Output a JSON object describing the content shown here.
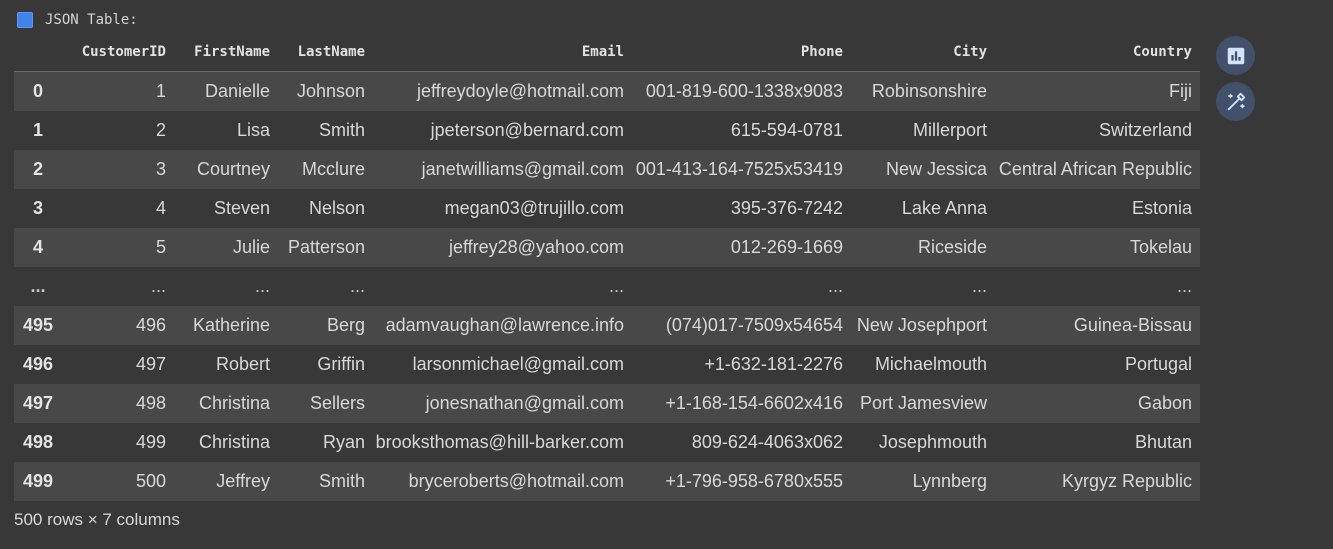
{
  "output_label": "JSON Table:",
  "table": {
    "index_header": "",
    "columns": [
      "CustomerID",
      "FirstName",
      "LastName",
      "Email",
      "Phone",
      "City",
      "Country"
    ],
    "rows": [
      {
        "index": "0",
        "cells": [
          "1",
          "Danielle",
          "Johnson",
          "jeffreydoyle@hotmail.com",
          "001-819-600-1338x9083",
          "Robinsonshire",
          "Fiji"
        ]
      },
      {
        "index": "1",
        "cells": [
          "2",
          "Lisa",
          "Smith",
          "jpeterson@bernard.com",
          "615-594-0781",
          "Millerport",
          "Switzerland"
        ]
      },
      {
        "index": "2",
        "cells": [
          "3",
          "Courtney",
          "Mcclure",
          "janetwilliams@gmail.com",
          "001-413-164-7525x53419",
          "New Jessica",
          "Central African Republic"
        ]
      },
      {
        "index": "3",
        "cells": [
          "4",
          "Steven",
          "Nelson",
          "megan03@trujillo.com",
          "395-376-7242",
          "Lake Anna",
          "Estonia"
        ]
      },
      {
        "index": "4",
        "cells": [
          "5",
          "Julie",
          "Patterson",
          "jeffrey28@yahoo.com",
          "012-269-1669",
          "Riceside",
          "Tokelau"
        ]
      },
      {
        "index": "...",
        "cells": [
          "...",
          "...",
          "...",
          "...",
          "...",
          "...",
          "..."
        ]
      },
      {
        "index": "495",
        "cells": [
          "496",
          "Katherine",
          "Berg",
          "adamvaughan@lawrence.info",
          "(074)017-7509x54654",
          "New Josephport",
          "Guinea-Bissau"
        ]
      },
      {
        "index": "496",
        "cells": [
          "497",
          "Robert",
          "Griffin",
          "larsonmichael@gmail.com",
          "+1-632-181-2276",
          "Michaelmouth",
          "Portugal"
        ]
      },
      {
        "index": "497",
        "cells": [
          "498",
          "Christina",
          "Sellers",
          "jonesnathan@gmail.com",
          "+1-168-154-6602x416",
          "Port Jamesview",
          "Gabon"
        ]
      },
      {
        "index": "498",
        "cells": [
          "499",
          "Christina",
          "Ryan",
          "brooksthomas@hill-barker.com",
          "809-624-4063x062",
          "Josephmouth",
          "Bhutan"
        ]
      },
      {
        "index": "499",
        "cells": [
          "500",
          "Jeffrey",
          "Smith",
          "bryceroberts@hotmail.com",
          "+1-796-958-6780x555",
          "Lynnberg",
          "Kyrgyz Republic"
        ]
      }
    ]
  },
  "footer": "500 rows × 7 columns",
  "side_buttons": [
    {
      "icon": "bar-chart-icon"
    },
    {
      "icon": "magic-wand-icon"
    }
  ],
  "colors": {
    "background": "#383838",
    "row_stripe": "#484848",
    "button_bg": "#42506b",
    "button_icon": "#d3e3fd",
    "label_icon": "#3f83e8"
  }
}
